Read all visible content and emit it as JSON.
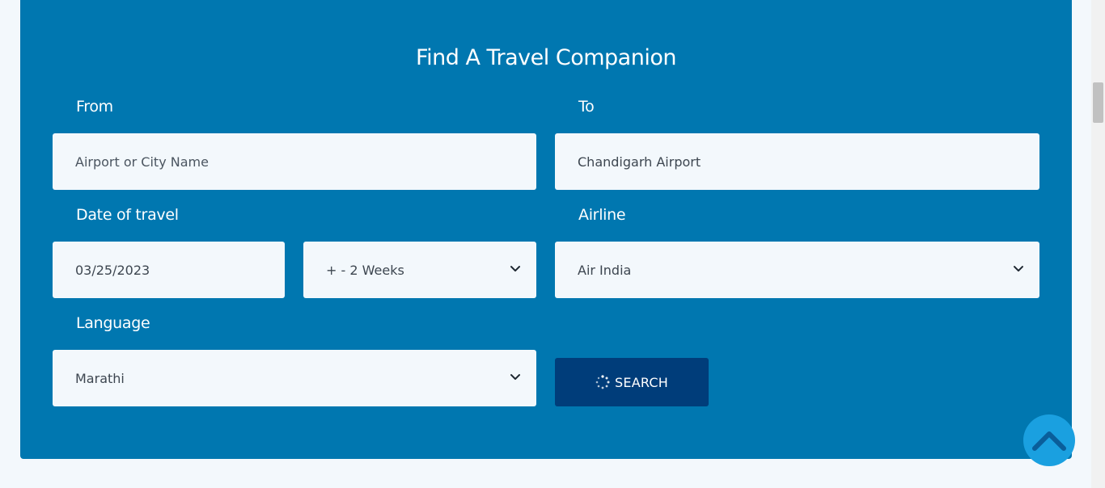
{
  "form": {
    "title": "Find A Travel Companion",
    "from": {
      "label": "From",
      "placeholder": "Airport or City Name",
      "value": ""
    },
    "to": {
      "label": "To",
      "value": "Chandigarh Airport"
    },
    "date": {
      "label": "Date of travel",
      "value": "03/25/2023",
      "range_value": "+ - 2 Weeks"
    },
    "airline": {
      "label": "Airline",
      "value": "Air India"
    },
    "language": {
      "label": "Language",
      "value": "Marathi"
    },
    "search_label": "SEARCH"
  },
  "colors": {
    "panel_bg": "#0077b0",
    "field_bg": "#f3f8fc",
    "button_bg": "#003d7a",
    "to_top_bg": "#1aa0e0"
  },
  "icons": {
    "select_arrow": "chevron-down-icon",
    "search_spinner": "loading-spinner-icon",
    "scroll_to_top": "chevron-up-icon"
  }
}
